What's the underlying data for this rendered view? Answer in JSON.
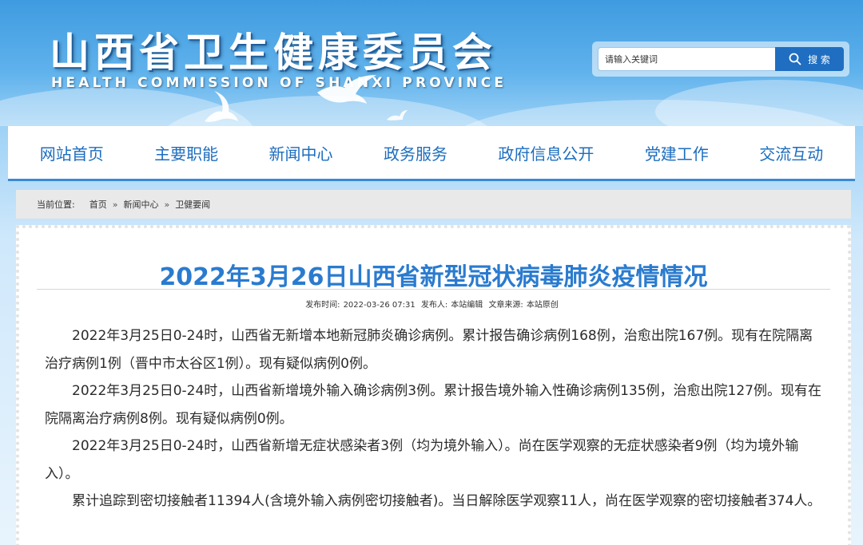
{
  "header": {
    "title": "山西省卫生健康委员会",
    "subtitle": "HEALTH COMMISSION OF SHANXI PROVINCE"
  },
  "search": {
    "placeholder": "请输入关键词",
    "button_label": "搜 索"
  },
  "nav": {
    "items": [
      "网站首页",
      "主要职能",
      "新闻中心",
      "政务服务",
      "政府信息公开",
      "党建工作",
      "交流互动"
    ]
  },
  "breadcrumb": {
    "label": "当前位置:",
    "items": [
      "首页",
      "新闻中心",
      "卫健要闻"
    ],
    "separator": "»"
  },
  "article": {
    "title": "2022年3月26日山西省新型冠状病毒肺炎疫情情况",
    "meta": {
      "publish_time_label": "发布时间:",
      "publish_time": "2022-03-26 07:31",
      "publisher_label": "发布人:",
      "publisher": "本站编辑",
      "source_label": "文章来源:",
      "source": "本站原创"
    },
    "paragraphs": [
      "2022年3月25日0-24时，山西省无新增本地新冠肺炎确诊病例。累计报告确诊病例168例，治愈出院167例。现有在院隔离治疗病例1例（晋中市太谷区1例）。现有疑似病例0例。",
      "2022年3月25日0-24时，山西省新增境外输入确诊病例3例。累计报告境外输入性确诊病例135例，治愈出院127例。现有在院隔离治疗病例8例。现有疑似病例0例。",
      "2022年3月25日0-24时，山西省新增无症状感染者3例（均为境外输入）。尚在医学观察的无症状感染者9例（均为境外输入）。",
      "累计追踪到密切接触者11394人(含境外输入病例密切接触者)。当日解除医学观察11人，尚在医学观察的密切接触者374人。"
    ]
  },
  "colors": {
    "brand_blue": "#1c6dbf",
    "title_blue": "#2a7bcf",
    "search_button": "#1f6ec1"
  }
}
